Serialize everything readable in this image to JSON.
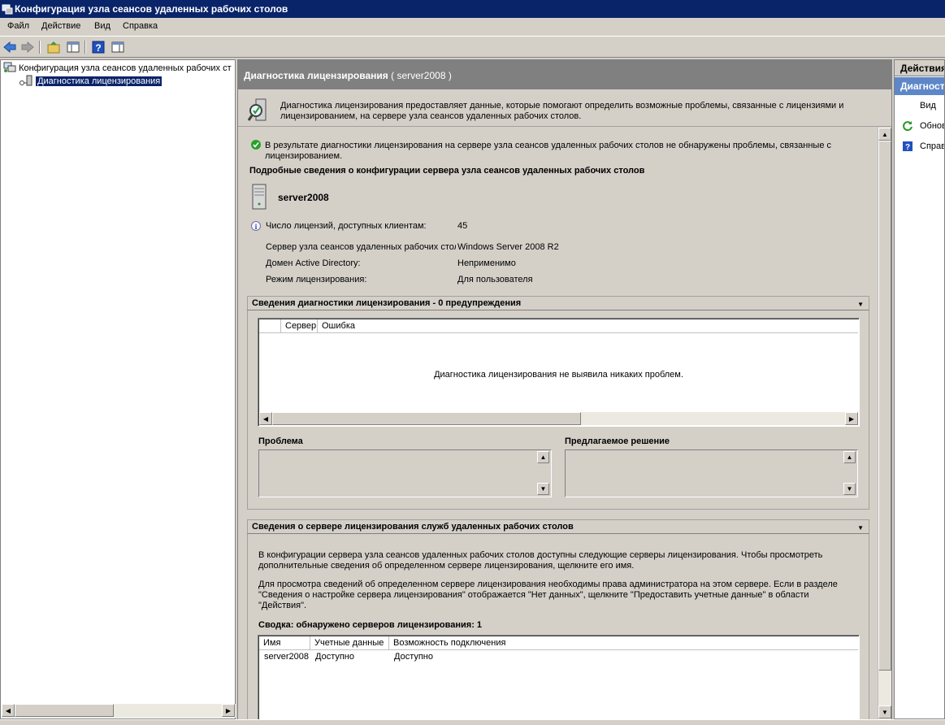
{
  "window": {
    "title": "Конфигурация узла сеансов удаленных рабочих столов"
  },
  "menu": {
    "file": "Файл",
    "action": "Действие",
    "view": "Вид",
    "help": "Справка"
  },
  "tree": {
    "root": "Конфигурация узла сеансов удаленных рабочих ст",
    "child": "Диагностика лицензирования"
  },
  "header": {
    "title": "Диагностика лицензирования",
    "server": "( server2008 )"
  },
  "description": "Диагностика лицензирования предоставляет данные, которые помогают определить возможные проблемы, связанные с лицензиями и лицензированием, на сервере узла сеансов удаленных рабочих столов.",
  "result": {
    "message": "В результате диагностики лицензирования на сервере узла сеансов удаленных рабочих столов не обнаружены проблемы, связанные с лицензированием.",
    "details_heading": "Подробные сведения о конфигурации сервера узла сеансов удаленных рабочих столов",
    "server_name": "server2008"
  },
  "info": {
    "licenses_label": "Число лицензий, доступных клиентам:",
    "licenses_value": "45",
    "host_label": "Сервер узла сеансов удаленных рабочих стол",
    "host_value": "Windows Server 2008 R2",
    "domain_label": "Домен Active Directory:",
    "domain_value": "Неприменимо",
    "mode_label": "Режим лицензирования:",
    "mode_value": "Для пользователя"
  },
  "diag": {
    "title": "Сведения диагностики лицензирования - 0 предупреждения",
    "col_server": "Сервер",
    "col_error": "Ошибка",
    "empty": "Диагностика лицензирования не выявила никаких проблем.",
    "problem_label": "Проблема",
    "solution_label": "Предлагаемое решение"
  },
  "license_servers": {
    "title": "Сведения о сервере лицензирования служб удаленных рабочих столов",
    "para1": "В конфигурации сервера узла сеансов удаленных рабочих столов доступны следующие серверы лицензирования. Чтобы просмотреть дополнительные сведения об определенном сервере лицензирования, щелкните его имя.",
    "para2": "Для просмотра сведений об определенном сервере лицензирования необходимы права администратора на этом сервере. Если в разделе \"Сведения о настройке сервера лицензирования\" отображается \"Нет данных\", щелкните \"Предоставить учетные данные\" в области \"Действия\".",
    "summary": "Сводка: обнаружено серверов лицензирования: 1",
    "columns": [
      "Имя",
      "Учетные данные",
      "Возможность подключения"
    ],
    "rows": [
      {
        "name": "server2008",
        "credentials": "Доступно",
        "connectivity": "Доступно"
      }
    ]
  },
  "actions": {
    "title": "Действия",
    "selected": "Диагност",
    "view": "Вид",
    "refresh": "Обнов",
    "help": "Справ"
  }
}
